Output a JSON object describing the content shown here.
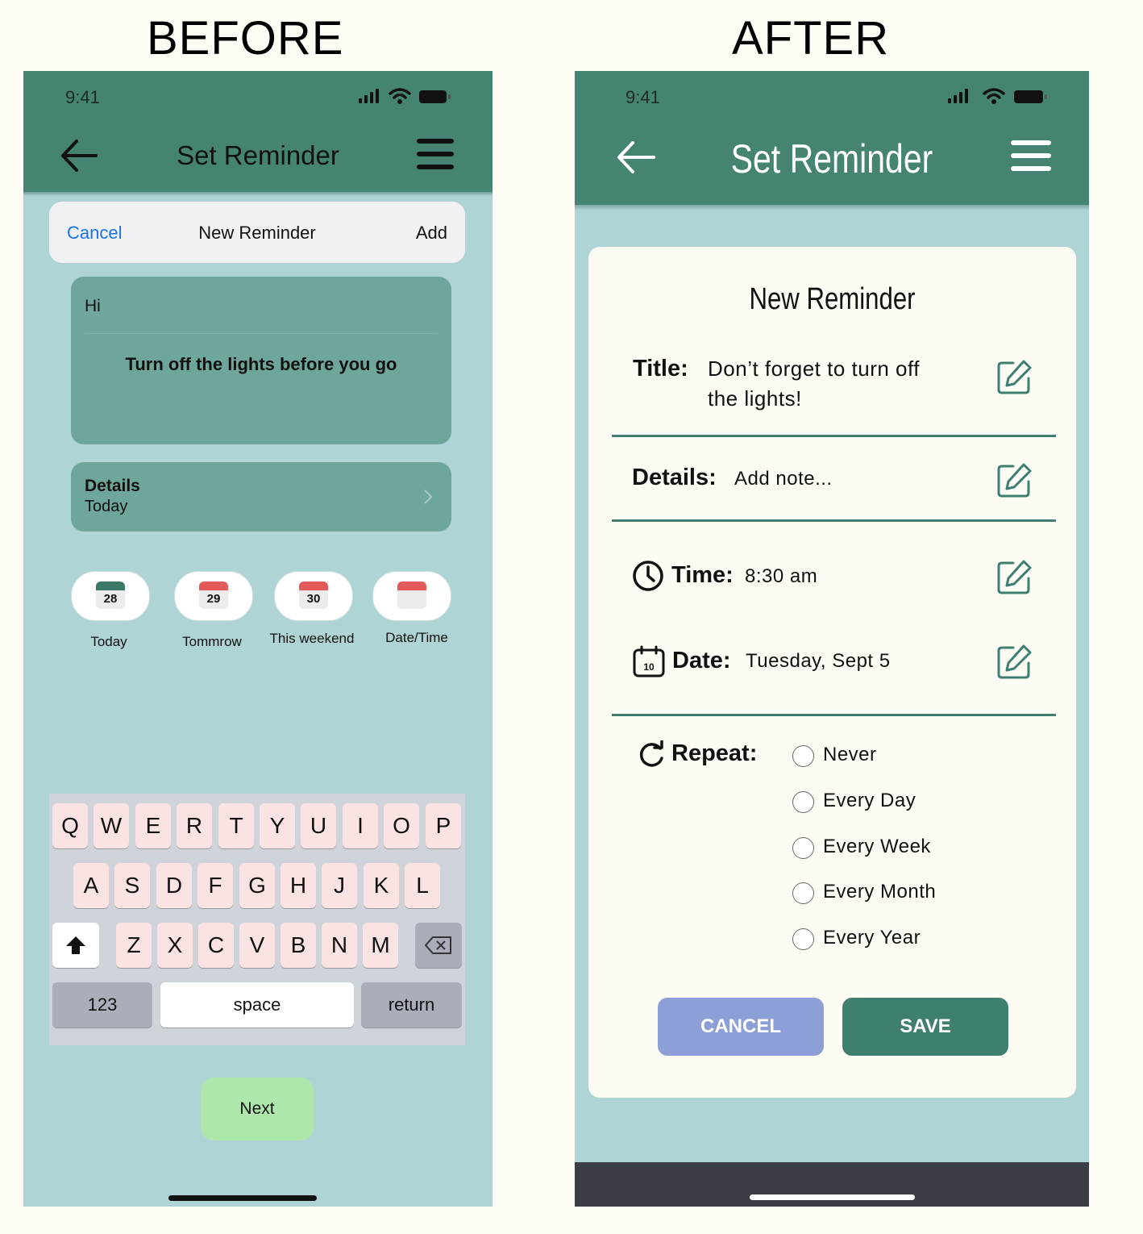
{
  "headings": {
    "before": "BEFORE",
    "after": "AFTER"
  },
  "colors": {
    "header_green": "#458373",
    "page_teal": "#afd4d5",
    "cancel_blue": "#8c9fd6",
    "save_green": "#3f7f70",
    "next_green": "#ade7ab",
    "ios_blue": "#1a73e8"
  },
  "before": {
    "status_time": "9:41",
    "title": "Set Reminder",
    "top_card": {
      "cancel": "Cancel",
      "title": "New Reminder",
      "add": "Add"
    },
    "note": {
      "line1": "Hi",
      "line2": "Turn off the lights before you go"
    },
    "details": {
      "title": "Details",
      "subtitle": "Today"
    },
    "date_chips": [
      {
        "day": "28",
        "label": "Today",
        "color": "#3b7a69"
      },
      {
        "day": "29",
        "label": "Tommrow",
        "color": "#e25a5a"
      },
      {
        "day": "30",
        "label": "This weekend",
        "color": "#e25a5a"
      },
      {
        "day": "",
        "label": "Date/Time",
        "color": "#e25a5a"
      }
    ],
    "keyboard": {
      "row1": [
        "Q",
        "W",
        "E",
        "R",
        "T",
        "Y",
        "U",
        "I",
        "O",
        "P"
      ],
      "row2": [
        "A",
        "S",
        "D",
        "F",
        "G",
        "H",
        "J",
        "K",
        "L"
      ],
      "row3": [
        "Z",
        "X",
        "C",
        "V",
        "B",
        "N",
        "M"
      ],
      "numbers": "123",
      "space": "space",
      "return": "return"
    },
    "next": "Next"
  },
  "after": {
    "status_time": "9:41",
    "title": "Set Reminder",
    "card_title": "New Reminder",
    "title_field": {
      "label": "Title:",
      "value_line1": "Don’t forget to turn off",
      "value_line2": "the lights!"
    },
    "details_field": {
      "label": "Details:",
      "value": "Add note..."
    },
    "time_field": {
      "label": "Time:",
      "value": "8:30 am"
    },
    "date_field": {
      "label": "Date:",
      "value": "Tuesday, Sept 5",
      "icon_day": "10"
    },
    "repeat_label": "Repeat:",
    "repeat_options": [
      "Never",
      "Every Day",
      "Every Week",
      "Every Month",
      "Every Year"
    ],
    "cancel": "CANCEL",
    "save": "SAVE"
  }
}
